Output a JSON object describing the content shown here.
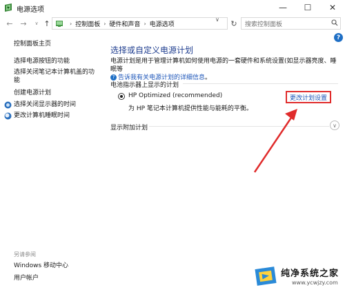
{
  "window": {
    "title": "电源选项",
    "icon": "power-options-icon",
    "buttons": {
      "minimize": "—",
      "maximize": "☐",
      "close": "✕"
    }
  },
  "addressbar": {
    "breadcrumbs": [
      "控制面板",
      "硬件和声音",
      "电源选项"
    ],
    "separator": "›",
    "search_placeholder": "搜索控制面板"
  },
  "nav_icons": {
    "back": "←",
    "forward": "→",
    "dropdown": "∨",
    "up": "↑",
    "refresh": "↻"
  },
  "help_label": "?",
  "sidebar": {
    "items": [
      {
        "label": "控制面板主页"
      },
      {
        "label": "选择电源按钮的功能"
      },
      {
        "label": "选择关闭笔记本计算机盖的功\n能"
      },
      {
        "label": "创建电源计划"
      },
      {
        "label": "选择关闭显示器的时间"
      },
      {
        "label": "更改计算机睡眠时间"
      }
    ],
    "see_also": {
      "heading": "另请参阅",
      "items": [
        {
          "label": "Windows 移动中心"
        },
        {
          "label": "用户帐户"
        }
      ]
    }
  },
  "main": {
    "title": "选择或自定义电源计划",
    "description": "电源计划是用于管理计算机如何使用电源的一套硬件和系统设置(如显示器亮度、睡眠等",
    "description_end": "。",
    "description_link": "告诉我有关电源计划的详细信息",
    "battery_section": "电池指示器上显示的计划",
    "plan": {
      "name": "HP Optimized (recommended)",
      "description": "为 HP 笔记本计算机提供性能与能耗的平衡。",
      "selected": true,
      "change_link": "更改计划设置"
    },
    "extra_plans": "显示附加计划",
    "expand_icon": "∨"
  },
  "watermark": {
    "title": "纯净系统之家",
    "url": "www.ycwjzy.com"
  },
  "colors": {
    "accent_title": "#1e3d8f",
    "link": "#1d56b9",
    "highlight_box": "#e02b2b",
    "arrow": "#e02b2b"
  }
}
